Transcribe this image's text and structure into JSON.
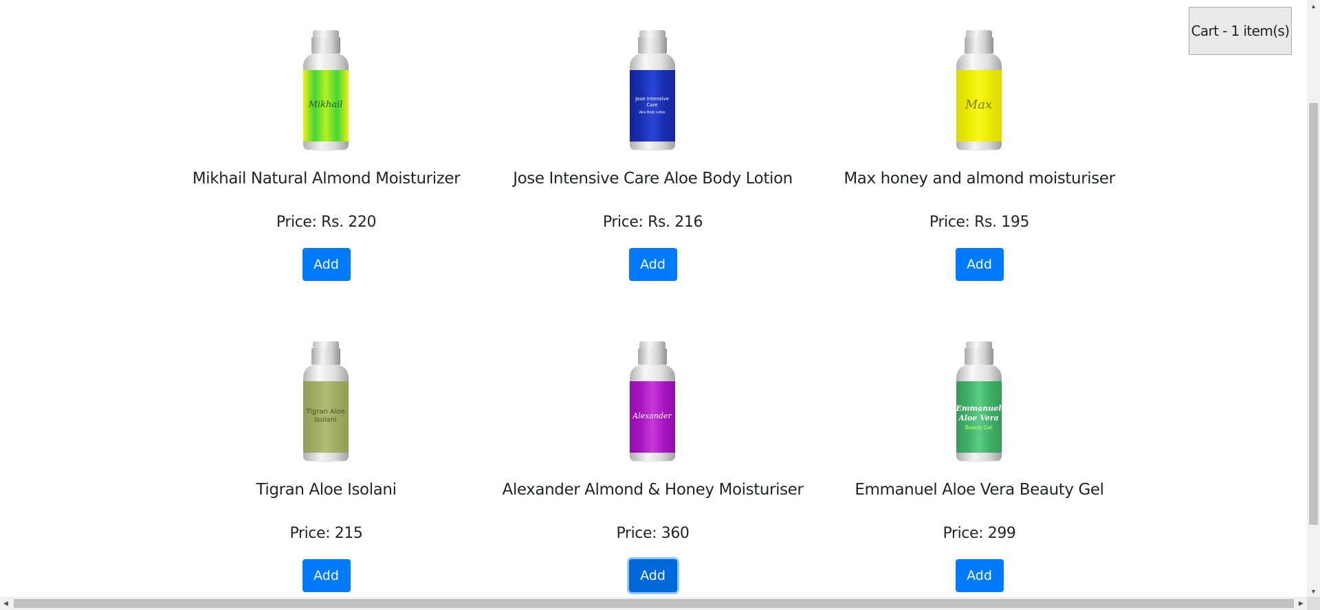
{
  "cart": {
    "label": "Cart - 1 item(s)"
  },
  "products": [
    {
      "name": "Mikhail Natural Almond Moisturizer",
      "price": "Price: Rs. 220",
      "add_label": "Add",
      "bottle": {
        "label_text": "Mikhail",
        "label_sub": "",
        "colors": [
          "#44d63a",
          "#b6f01f",
          "#f2f20c"
        ],
        "text_color": "#2a5a10"
      }
    },
    {
      "name": "Jose Intensive Care Aloe Body Lotion",
      "price": "Price: Rs. 216",
      "add_label": "Add",
      "bottle": {
        "label_text": "Jose Intensive Care",
        "label_sub": "Aloe Body Lotion",
        "colors": [
          "#1a2fb0",
          "#2a45d8",
          "#16249a"
        ],
        "text_color": "#ffffff"
      }
    },
    {
      "name": "Max honey and almond moisturiser",
      "price": "Price: Rs. 195",
      "add_label": "Add",
      "bottle": {
        "label_text": "Max",
        "label_sub": "",
        "colors": [
          "#e8e800",
          "#f9f91c",
          "#dcdc00"
        ],
        "text_color": "#7a7a00"
      }
    },
    {
      "name": "Tigran Aloe Isolani",
      "price": "Price: 215",
      "add_label": "Add",
      "bottle": {
        "label_text": "Tigran Aloe Isolani",
        "label_sub": "",
        "colors": [
          "#9eab61",
          "#b2bd78",
          "#919e55"
        ],
        "text_color": "#4c5228"
      }
    },
    {
      "name": "Alexander Almond & Honey Moisturiser",
      "price": "Price: 360",
      "add_label": "Add",
      "bottle": {
        "label_text": "Alexander",
        "label_sub": "",
        "colors": [
          "#a715c2",
          "#c63ad8",
          "#900fa8"
        ],
        "text_color": "#ffffff"
      }
    },
    {
      "name": "Emmanuel Aloe Vera Beauty Gel",
      "price": "Price: 299",
      "add_label": "Add",
      "bottle": {
        "label_text": "Emmanuel Aloe Vera",
        "label_sub": "Beauty Gel",
        "colors": [
          "#3fae67",
          "#5ccb84",
          "#349a59"
        ],
        "text_color": "#ffffff"
      }
    }
  ],
  "theme": {
    "accent": "#007bff",
    "text": "#212529"
  }
}
